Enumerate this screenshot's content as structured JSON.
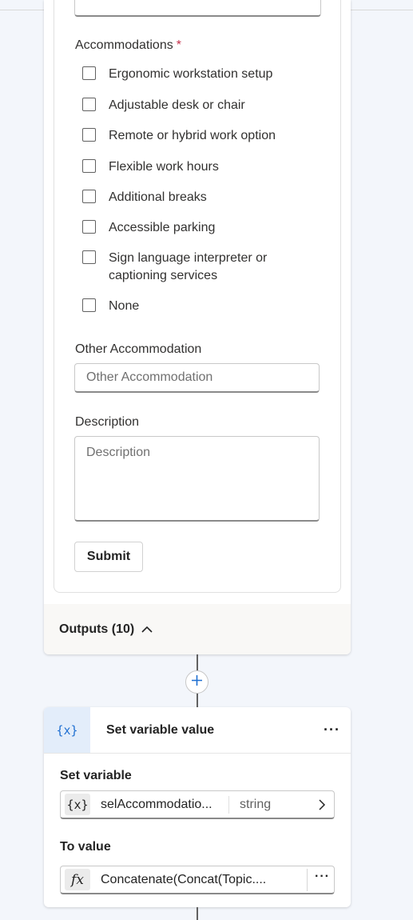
{
  "form": {
    "accommodations_label": "Accommodations",
    "required_marker": "*",
    "options": [
      {
        "label": "Ergonomic workstation setup"
      },
      {
        "label": "Adjustable desk or chair"
      },
      {
        "label": "Remote or hybrid work option"
      },
      {
        "label": "Flexible work hours"
      },
      {
        "label": "Additional breaks"
      },
      {
        "label": "Accessible parking"
      },
      {
        "label": "Sign language interpreter or captioning services"
      },
      {
        "label": "None"
      }
    ],
    "other_label": "Other Accommodation",
    "other_placeholder": "Other Accommodation",
    "description_label": "Description",
    "description_placeholder": "Description",
    "submit_label": "Submit"
  },
  "outputs": {
    "label": "Outputs (10)"
  },
  "set_variable_node": {
    "icon_text": "{x}",
    "title": "Set variable value",
    "more": "···",
    "set_variable_label": "Set variable",
    "variable_icon": "{x}",
    "variable_name": "selAccommodatio...",
    "variable_type": "string",
    "to_value_label": "To value",
    "formula_icon": "fx",
    "formula_text": "Concatenate(Concat(Topic....",
    "formula_more": "···"
  },
  "colors": {
    "accent": "#1f6fd1",
    "required": "#c4314b",
    "canvas": "#f3f6fb"
  }
}
